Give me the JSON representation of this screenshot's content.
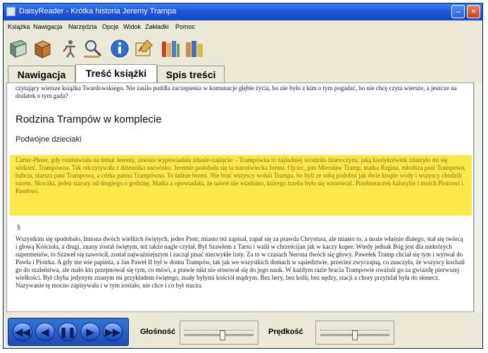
{
  "window": {
    "title": "DaisyReader - Krótka historia Jeremy Trampa"
  },
  "menubar": {
    "items": [
      "Książka",
      "Nawigacja",
      "Narzędzia",
      "Opcje",
      "Widok",
      "Zakładki",
      "Pomoc"
    ]
  },
  "toolbar": {
    "icons": [
      "book-icon",
      "box-icon",
      "accessibility-icon",
      "search-icon",
      "info-icon",
      "edit-icon",
      "library-icon",
      "books-icon"
    ]
  },
  "tabs": {
    "items": [
      "Nawigacja",
      "Treść książki",
      "Spis treści"
    ],
    "active_index": 1
  },
  "content": {
    "top_text": "czytający wiersze książka Twardowskiego. Nie zasilo puddla zaczepienia w komunacje głębie życia, bo nie było z kim o tym pogadać, bo nie chcę czyta wiersze, a jeszcze na dodatek o tym gada?",
    "heading": "Rodzina Trampów w komplecie",
    "subheading": "Podwójne dzieciaki",
    "highlight_text": "Carter-Pleier, gdy rozmawiała na temat Jeremy, zawsze wypowiadała zdanie-zaklęcie: - Trampówna to najładniej wradziła dziewczyna, jaką kiedykolwiek zdarzyło mi się widzieć. Trampówna. Tak odczytywała z dziennika nazwisko. Jeremie podobała się ta staroświecka forma. Ojciec, pan Mirosław Tramp, matka Regina, młodsza pani Trampowa, babcia, starsza pani Trampowa, a córka panna Trampówna. To ładnie brzmi. Nie brać wszyscy wołali Trampa, bo byli ze sobą podobni jak dwie krople wody i wszyscy chodzili razem. Skoczki, jeden starszy od drugiego o godzinę. Matka z opowiadała, że nawet nie wiadomo, którego trzeba było się wzorować. Przebieraczek kaloryfer i moich Piotrowi i Pawłowi.",
    "marker": "§",
    "body_text": "Wszystkim się spodobało. Imiona dwóch wielkich świętych, jeden Piotr, miasto też zapisał, zapał się za prawda Chrystusa, ale miasto to, a może właśnie dlatego, stał się twórcą i głową Kościoła, a drugi, znany został świętym, też także nagle czytał. Był Szawłem z Tarsu i walił w chrześcijan jak w kaczy kuper. Wtedy jednak Bóg jest dla niektórych supermenów, to Szaweł się nawrócił, został najważniejszym i zaczął pisać niezwykłe listy. Za to w czasach Nerona dwóch się głowy. Pawełek Tramp chciał się tym i wyrwał do Pawła i Piotrka. A gdy nie wie papieża, a Jan Paweł II był w domu Trampów, tak jak we wszystkich domach w sąsiedztwie, przecież zwyczajną, co znaczyła, że wszyscy kochali go do szaleństwa, ale mało kto przejmował się tym, co mówi, a prawie nikt nie stosował się do jego nauk. W każdym razie bracia Trampowie uważali go za gwiazdę pierwszej wielkości. Był chyba jedynym znanym mi przykładem świętego, znały byłymi kościół mądrym. Bez hery, bez kolii, bez nędzy, stacji a chory przytulał była do słonecz. Nazywanie tę mocno zapisywała i w tym zostało, nie chce i co był stacza."
  },
  "player": {
    "buttons": [
      "rewind-start",
      "step-back",
      "pause",
      "play",
      "fast-forward"
    ]
  },
  "volume": {
    "label": "Głośność",
    "level": 0.55
  },
  "speed": {
    "label": "Prędkość",
    "level": 0.5
  },
  "colors": {
    "titlebar": "#1f56d8",
    "highlight": "#fce84a",
    "player": "#2a62c8"
  }
}
